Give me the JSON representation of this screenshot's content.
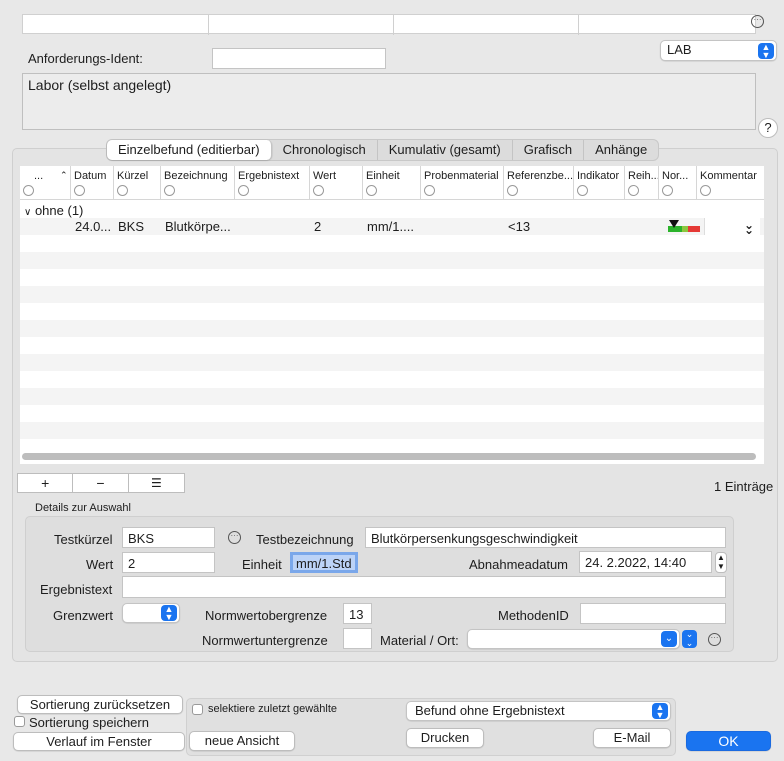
{
  "header": {
    "lab_popup": "LAB",
    "anforderung_label": "Anforderungs-Ident:",
    "anforderung_value": "",
    "labor_text": "Labor (selbst angelegt)",
    "help": "?"
  },
  "tabs": [
    {
      "label": "Einzelbefund (editierbar)",
      "active": true
    },
    {
      "label": "Chronologisch",
      "active": false
    },
    {
      "label": "Kumulativ (gesamt)",
      "active": false
    },
    {
      "label": "Grafisch",
      "active": false
    },
    {
      "label": "Anhänge",
      "active": false
    }
  ],
  "table": {
    "columns": [
      "...",
      "Datum",
      "Kürzel",
      "Bezeichnung",
      "Ergebnistext",
      "Wert",
      "Einheit",
      "Probenmaterial",
      "Referenzbe...",
      "Indikator",
      "Reih...",
      "Nor...",
      "Kommentar"
    ],
    "group": "ohne (1)",
    "rows": [
      {
        "datum": "24.0...",
        "kuerzel": "BKS",
        "bezeichnung": "Blutkörpe...",
        "ergebnistext": "",
        "wert": "2",
        "einheit": "mm/1....",
        "probenmaterial": "",
        "referenz": "<13",
        "indikator": "",
        "reihe": "",
        "kommentar": ""
      }
    ],
    "count": "1 Einträge"
  },
  "toolbar": {
    "add": "+",
    "remove": "−",
    "list": "☰"
  },
  "details": {
    "title": "Details zur Auswahl",
    "testkuerzel_label": "Testkürzel",
    "testkuerzel": "BKS",
    "testbezeichnung_label": "Testbezeichnung",
    "testbezeichnung": "Blutkörpersenkungsgeschwindigkeit",
    "wert_label": "Wert",
    "wert": "2",
    "einheit_label": "Einheit",
    "einheit": "mm/1.Std",
    "abnahme_label": "Abnahmeadatum",
    "abnahme": "24.  2.2022, 14:40",
    "ergebnistext_label": "Ergebnistext",
    "ergebnistext": "",
    "grenzwert_label": "Grenzwert",
    "normober_label": "Normwertobergrenze",
    "normober": "13",
    "methoden_label": "MethodenID",
    "methoden": "",
    "normunter_label": "Normwertuntergrenze",
    "normunter": "",
    "material_label": "Material / Ort:",
    "material": ""
  },
  "footer": {
    "sort_reset": "Sortierung zurücksetzen",
    "sort_save": "Sortierung speichern",
    "verlauf": "Verlauf im Fenster",
    "select_last": "selektiere zuletzt gewählte",
    "new_view": "neue Ansicht",
    "befund_popup": "Befund ohne Ergebnistext",
    "print": "Drucken",
    "email": "E-Mail",
    "ok": "OK"
  }
}
